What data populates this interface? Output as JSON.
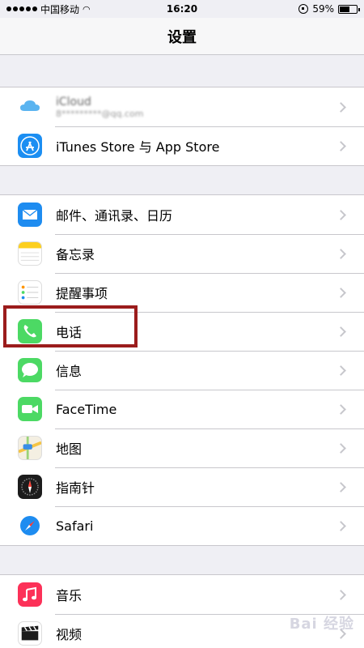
{
  "status": {
    "carrier": "中国移动",
    "time": "16:20",
    "battery": "59%",
    "battery_level": 0.59
  },
  "nav": {
    "title": "设置"
  },
  "groups": [
    {
      "items": [
        {
          "label": "iCloud",
          "sublabel": "8*********@qq.com",
          "icon": "icloud-icon"
        },
        {
          "label": "iTunes Store 与 App Store",
          "icon": "app-store-icon"
        }
      ]
    },
    {
      "items": [
        {
          "label": "邮件、通讯录、日历",
          "icon": "mail-icon"
        },
        {
          "label": "备忘录",
          "icon": "notes-icon"
        },
        {
          "label": "提醒事项",
          "icon": "reminders-icon"
        },
        {
          "label": "电话",
          "icon": "phone-icon"
        },
        {
          "label": "信息",
          "icon": "messages-icon"
        },
        {
          "label": "FaceTime",
          "icon": "facetime-icon"
        },
        {
          "label": "地图",
          "icon": "maps-icon"
        },
        {
          "label": "指南针",
          "icon": "compass-icon"
        },
        {
          "label": "Safari",
          "icon": "safari-icon"
        }
      ]
    },
    {
      "items": [
        {
          "label": "音乐",
          "icon": "music-icon"
        },
        {
          "label": "视频",
          "icon": "video-icon"
        }
      ]
    }
  ],
  "colors": {
    "background": "#efeff4",
    "highlight": "#9b1c1c",
    "phone": "#4cd964",
    "appstore": "#1b8ef2",
    "music": "#fc3158"
  },
  "watermark": "Bai 经验"
}
